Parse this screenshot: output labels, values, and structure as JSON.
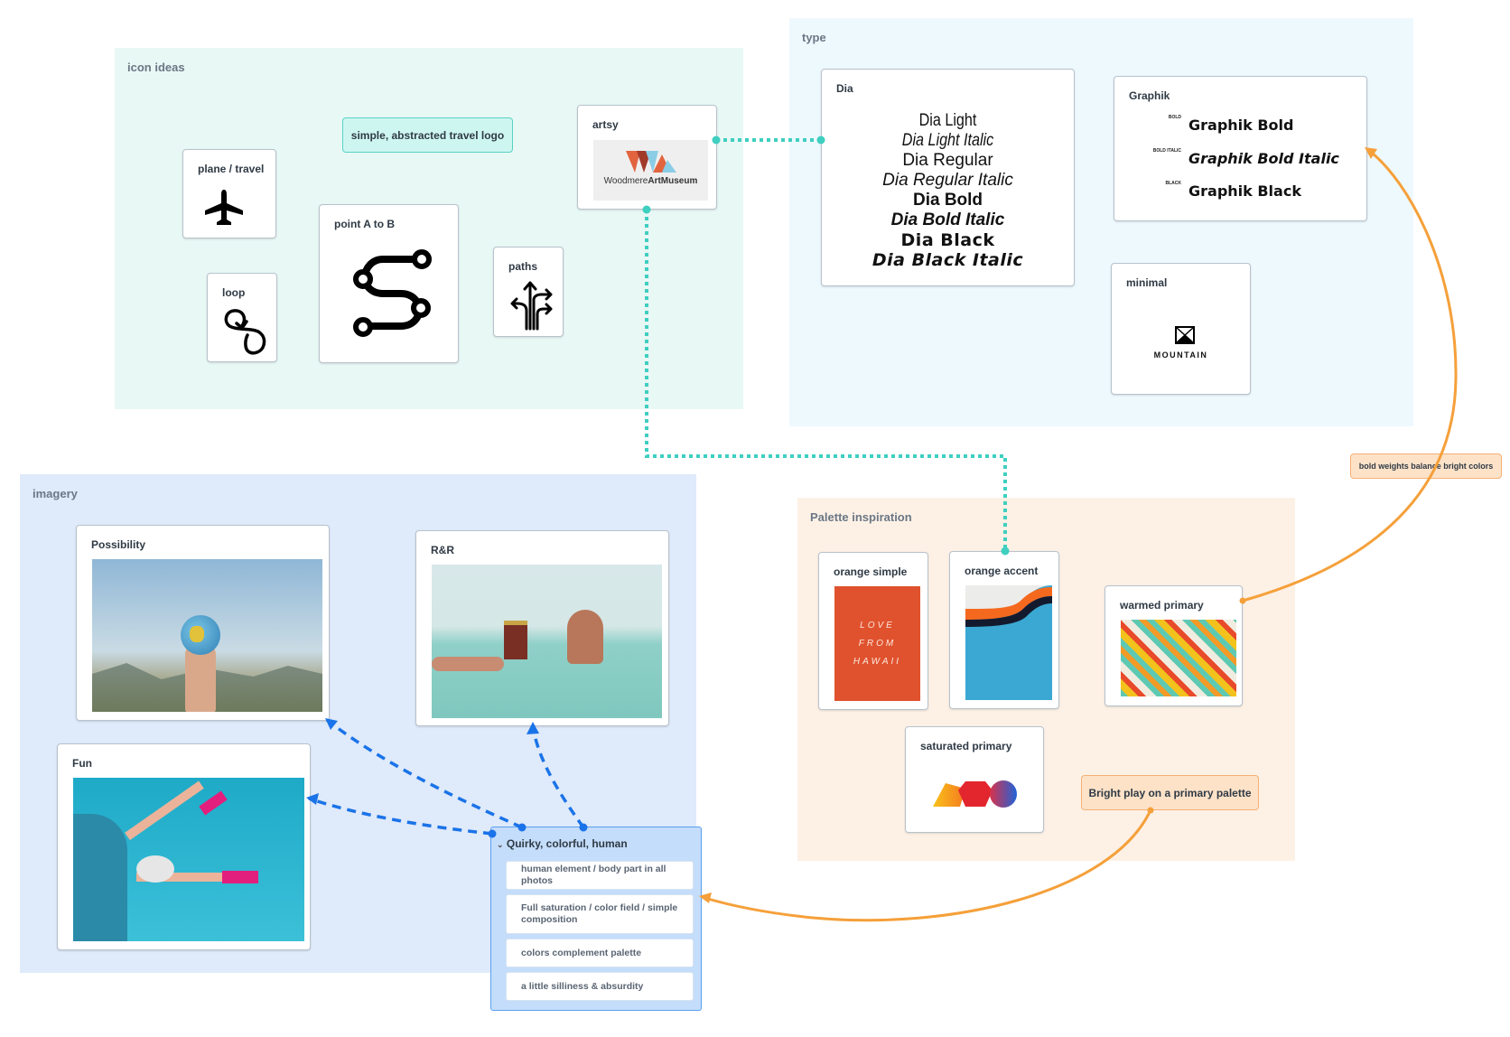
{
  "sections": {
    "icon_ideas": {
      "title": "icon ideas",
      "sticky": "simple, abstracted travel logo",
      "cards": {
        "plane": {
          "title": "plane / travel",
          "icon": "airplane-icon"
        },
        "loop": {
          "title": "loop",
          "icon": "loop-icon"
        },
        "point_ab": {
          "title": "point A to B",
          "icon": "route-icon"
        },
        "paths": {
          "title": "paths",
          "icon": "split-arrows-icon"
        },
        "artsy": {
          "title": "artsy",
          "logo_text_regular": "Woodmere",
          "logo_text_bold": "ArtMuseum"
        }
      }
    },
    "type": {
      "title": "type",
      "dia": {
        "title": "Dia",
        "samples": [
          "Dia Light",
          "Dia Light Italic",
          "Dia Regular",
          "Dia Regular Italic",
          "Dia Bold",
          "Dia Bold Italic",
          "Dia Black",
          "Dia Black Italic"
        ]
      },
      "graphik": {
        "title": "Graphik",
        "rows": [
          {
            "tag": "BOLD",
            "name": "Graphik Bold"
          },
          {
            "tag": "BOLD ITALIC",
            "name": "Graphik Bold Italic"
          },
          {
            "tag": "BLACK",
            "name": "Graphik Black"
          }
        ]
      },
      "minimal": {
        "title": "minimal",
        "logo_text": "MOUNTAIN"
      }
    },
    "imagery": {
      "title": "imagery",
      "cards": {
        "possibility": {
          "title": "Possibility",
          "image": "hand holding globe over mountains"
        },
        "rr": {
          "title": "R&R",
          "image": "man reading book floating in sea"
        },
        "fun": {
          "title": "Fun",
          "image": "legs in pink socks out of car window"
        }
      },
      "group": {
        "title": "Quirky, colorful, human",
        "items": [
          "human element / body part in all photos",
          "Full saturation / color field / simple composition",
          "colors complement palette",
          "a little silliness & absurdity"
        ]
      }
    },
    "palette": {
      "title": "Palette inspiration",
      "cards": {
        "orange_simple": {
          "title": "orange simple",
          "image_text": [
            "LOVE",
            "FROM",
            "HAWAII"
          ]
        },
        "orange_accent": {
          "title": "orange accent"
        },
        "warmed_primary": {
          "title": "warmed primary"
        },
        "saturated_primary": {
          "title": "saturated primary"
        }
      },
      "sticky": "Bright play on a primary palette"
    }
  },
  "floating_sticky": "bold weights balance bright colors",
  "colors": {
    "teal_connector": "#3ecfc0",
    "blue_connector": "#1a73e8",
    "orange_connector": "#f5a03a",
    "icon_bg": "#e8f8f5",
    "type_bg": "#eef9fe",
    "imagery_bg": "#dfeafa",
    "palette_bg": "#fdf1e6"
  }
}
